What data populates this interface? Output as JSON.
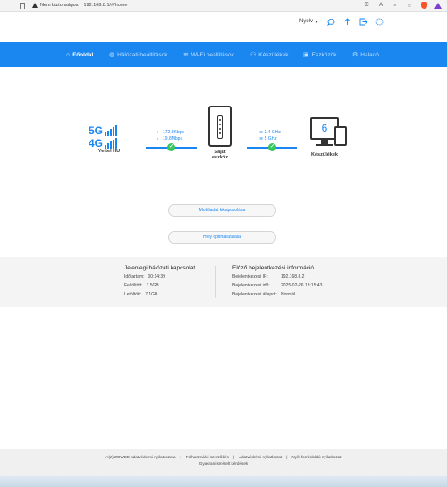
{
  "browser": {
    "security_label": "Nem biztonságos",
    "url": "192.168.8.1/#/home"
  },
  "header": {
    "language": "Nyelv"
  },
  "nav": {
    "items": [
      {
        "label": "Főoldal",
        "icon": "home-icon",
        "active": true
      },
      {
        "label": "Hálózati beállítások",
        "icon": "globe-icon",
        "active": false
      },
      {
        "label": "Wi-Fi beállítások",
        "icon": "wifi-icon",
        "active": false
      },
      {
        "label": "Készülékek",
        "icon": "devices-icon",
        "active": false
      },
      {
        "label": "Eszközök",
        "icon": "toolbox-icon",
        "active": false
      },
      {
        "label": "Haladó",
        "icon": "gear-icon",
        "active": false
      }
    ]
  },
  "status": {
    "network_5g": "5G",
    "network_4g": "4G",
    "operator": "Yettel HU",
    "upload_speed": "172.8Kbps",
    "download_speed": "19.8Mbps",
    "router_label_line1": "Saját",
    "router_label_line2": "eszköz",
    "band_24": "2.4 GHz",
    "band_5": "5 GHz",
    "device_count": "6",
    "devices_label": "Készülékek"
  },
  "actions": {
    "mobile_data_button": "Mobiladat kikapcsolása",
    "optimize_button": "Hely optimalizálása"
  },
  "connection": {
    "title": "Jelenlegi hálózati kapcsolat",
    "rows": [
      {
        "k": "Időtartam:",
        "v": "00:14:39"
      },
      {
        "k": "Feltöltött:",
        "v": "1.5GB"
      },
      {
        "k": "Letöltött:",
        "v": "7.1GB"
      }
    ]
  },
  "login": {
    "title": "Előző bejelentkezési információ",
    "rows": [
      {
        "k": "Bejelentkezési IP:",
        "v": "192.168.8.2"
      },
      {
        "k": "Bejelentkezési idő:",
        "v": "2025-02-26 13:15:43"
      },
      {
        "k": "Bejelentkezési állapot:",
        "v": "Normál"
      }
    ]
  },
  "footer": {
    "links": [
      "A(z) ZOWEE adatvédelmi nyilatkozata",
      "Felhasználói szerződés",
      "Adatvédelmi nyilatkozat",
      "Nyílt forráskódú nyilatkozat"
    ],
    "faq": "Gyakran ismételt kérdések"
  },
  "colors": {
    "accent": "#1a86f0",
    "ok": "#34c759"
  }
}
